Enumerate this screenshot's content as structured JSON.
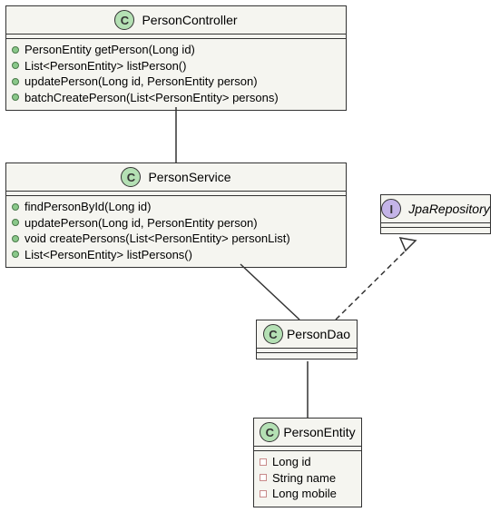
{
  "classes": {
    "controller": {
      "name": "PersonController",
      "methods": [
        "PersonEntity getPerson(Long id)",
        "List<PersonEntity> listPerson()",
        "updatePerson(Long id, PersonEntity person)",
        "batchCreatePerson(List<PersonEntity> persons)"
      ]
    },
    "service": {
      "name": "PersonService",
      "methods": [
        "findPersonById(Long id)",
        "updatePerson(Long id, PersonEntity person)",
        "void createPersons(List<PersonEntity> personList)",
        "List<PersonEntity> listPersons()"
      ]
    },
    "dao": {
      "name": "PersonDao"
    },
    "entity": {
      "name": "PersonEntity",
      "fields": [
        "Long id",
        "String name",
        "Long mobile"
      ]
    },
    "repo": {
      "name": "JpaRepository"
    }
  }
}
